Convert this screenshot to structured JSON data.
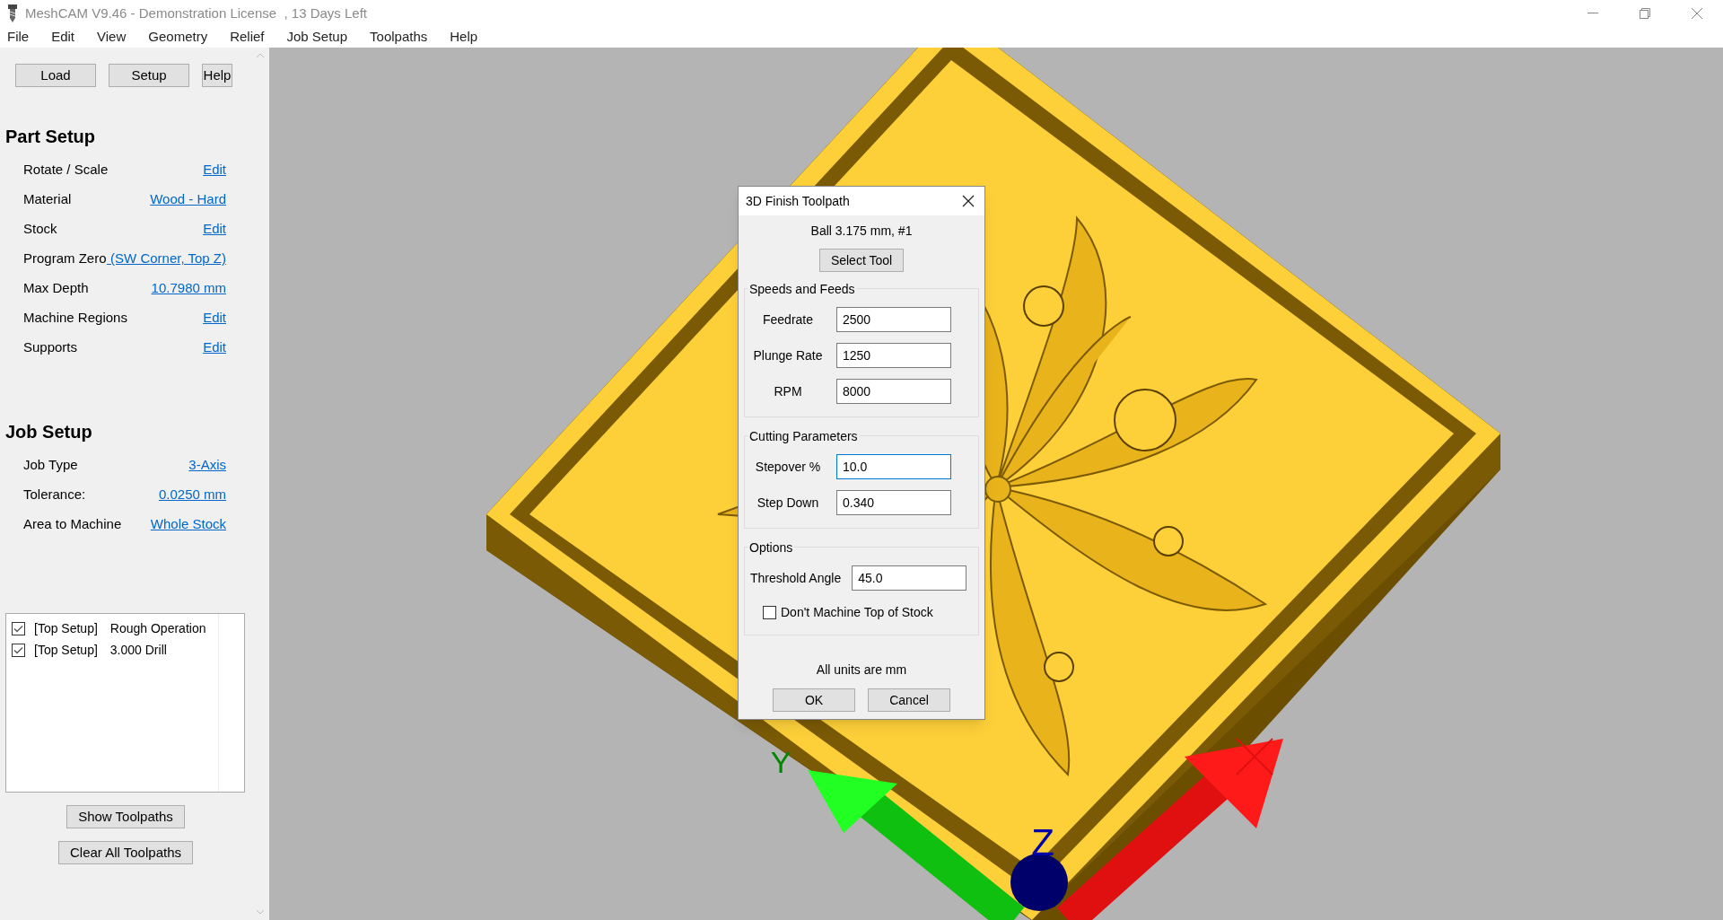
{
  "window": {
    "title": "MeshCAM V9.46 - Demonstration License  , 13 Days Left"
  },
  "menu": [
    "File",
    "Edit",
    "View",
    "Geometry",
    "Relief",
    "Job Setup",
    "Toolpaths",
    "Help"
  ],
  "toolbar_buttons": [
    "Load",
    "Setup",
    "Help"
  ],
  "sections": [
    {
      "title": "Part Setup",
      "rows": [
        {
          "label": "Rotate / Scale",
          "value": "Edit"
        },
        {
          "label": "Material",
          "value": "Wood - Hard"
        },
        {
          "label": "Stock",
          "value": "Edit"
        },
        {
          "label": "Program Zero",
          "value": " (SW Corner, Top Z)"
        },
        {
          "label": "Max Depth",
          "value": "10.7980 mm"
        },
        {
          "label": "Machine Regions",
          "value": "Edit"
        },
        {
          "label": "Supports",
          "value": "Edit"
        }
      ]
    },
    {
      "title": "Job Setup",
      "rows": [
        {
          "label": "Job Type",
          "value": "3-Axis"
        },
        {
          "label": "Tolerance:",
          "value": "0.0250 mm"
        },
        {
          "label": "Area to Machine",
          "value": "Whole Stock"
        }
      ]
    }
  ],
  "operations": [
    {
      "setup": "[Top Setup]",
      "name": "Rough Operation",
      "checked": true
    },
    {
      "setup": "[Top Setup]",
      "name": "3.000 Drill",
      "checked": true
    }
  ],
  "panel_buttons": [
    "Show Toolpaths",
    "Clear All Toolpaths"
  ],
  "dialog": {
    "title": "3D Finish Toolpath",
    "tool": "Ball 3.175 mm, #1",
    "select_button": "Select Tool",
    "groups": [
      {
        "title": "Speeds and Feeds",
        "fields": [
          {
            "label": "Feedrate",
            "value": "2500",
            "focused": false
          },
          {
            "label": "Plunge Rate",
            "value": "1250",
            "focused": false
          },
          {
            "label": "RPM",
            "value": "8000",
            "focused": false
          }
        ]
      },
      {
        "title": "Cutting Parameters",
        "fields": [
          {
            "label": "Stepover %",
            "value": "10.0",
            "focused": true
          },
          {
            "label": "Step Down",
            "value": "0.340",
            "focused": false
          }
        ]
      },
      {
        "title": "Options",
        "fields": [
          {
            "label": "Threshold Angle",
            "value": "45.0",
            "focused": false
          }
        ],
        "checkbox": {
          "label": "Don't Machine Top of Stock",
          "checked": false
        }
      }
    ],
    "note": "All units are mm",
    "buttons": [
      "OK",
      "Cancel"
    ]
  },
  "viewport": {
    "axis_labels": [
      "Y",
      "Z"
    ]
  }
}
